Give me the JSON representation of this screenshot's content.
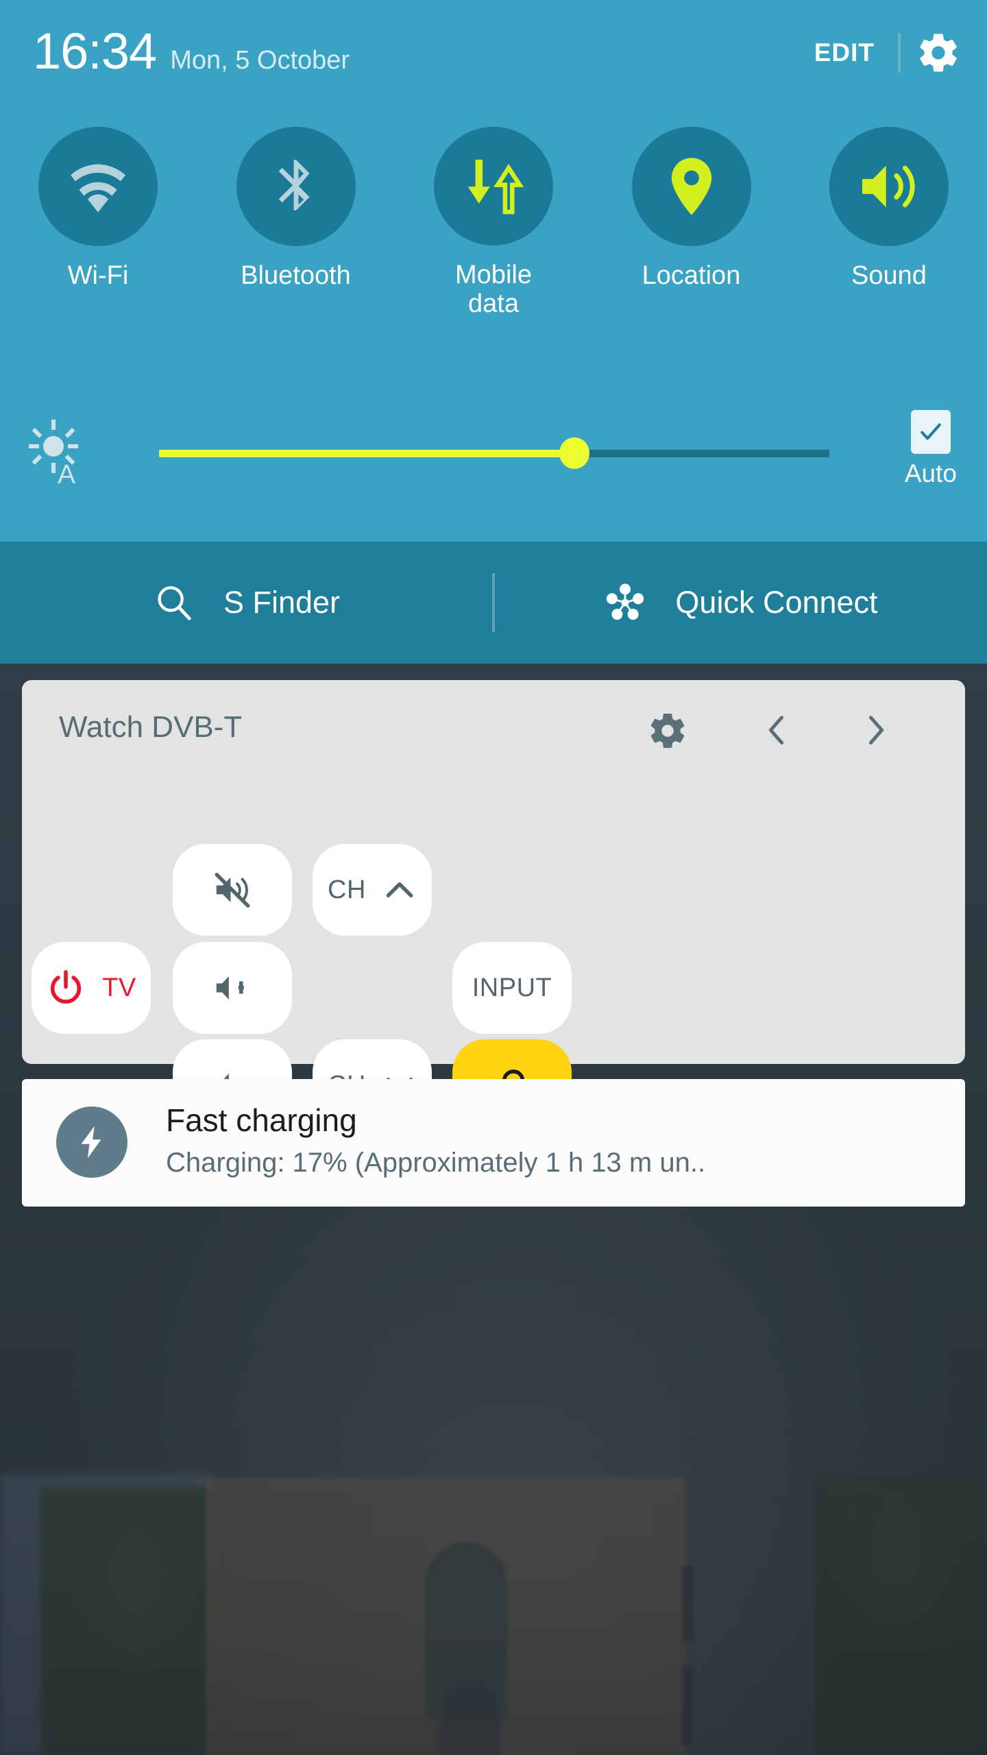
{
  "statusbar": {
    "time": "16:34",
    "date": "Mon, 5 October",
    "edit_label": "EDIT",
    "settings_icon": "gear-icon"
  },
  "toggles": [
    {
      "label": "Wi-Fi",
      "icon": "wifi-icon",
      "active": false
    },
    {
      "label": "Bluetooth",
      "icon": "bluetooth-icon",
      "active": false
    },
    {
      "label": "Mobile\ndata",
      "icon": "mobile-data-icon",
      "active": true
    },
    {
      "label": "Location",
      "icon": "location-pin-icon",
      "active": true
    },
    {
      "label": "Sound",
      "icon": "speaker-icon",
      "active": true
    }
  ],
  "brightness": {
    "icon": "brightness-auto-icon",
    "value_percent": 62,
    "auto_label": "Auto",
    "auto_checked": true
  },
  "shortcuts": {
    "s_finder_label": "S Finder",
    "s_finder_icon": "search-icon",
    "quick_connect_label": "Quick Connect",
    "quick_connect_icon": "hub-nodes-icon"
  },
  "remote": {
    "title": "Watch DVB-T",
    "gear_icon": "gear-icon",
    "prev_icon": "chevron-left-icon",
    "next_icon": "chevron-right-icon",
    "buttons": {
      "mute": {
        "icon": "volume-mute-icon",
        "label": ""
      },
      "ch_up": {
        "icon": "chevron-up-icon",
        "label": "CH"
      },
      "power": {
        "icon": "power-icon",
        "label": "TV"
      },
      "vol_up": {
        "icon": "volume-up-icon",
        "label": ""
      },
      "input": {
        "icon": "",
        "label": "INPUT"
      },
      "vol_dn": {
        "icon": "volume-down-icon",
        "label": ""
      },
      "ch_dn": {
        "icon": "chevron-down-icon",
        "label": "CH"
      },
      "peel": {
        "icon": "peel-logo-icon",
        "label": ""
      }
    }
  },
  "notification": {
    "icon": "lightning-bolt-icon",
    "title": "Fast charging",
    "subtitle": "Charging: 17% (Approximately 1 h 13 m un.."
  },
  "colors": {
    "panel_bg": "#3aa2c3",
    "finder_bg": "#1f7e99",
    "toggle_circle": "#1b7a97",
    "accent_active": "#d4ef1f",
    "accent_inactive": "#b6d3dc",
    "slider_fill": "#edff33",
    "card_bg": "#e2e4e3",
    "power_red": "#e8172b",
    "peel_yellow": "#ffd312"
  }
}
